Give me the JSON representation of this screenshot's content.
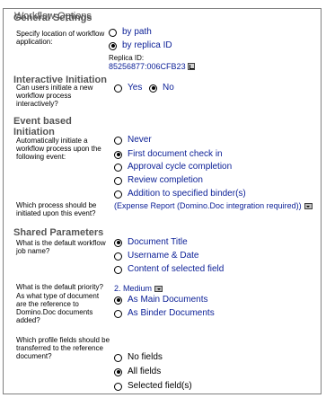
{
  "legend": "Workflow Options",
  "sections": {
    "general": "General Settings",
    "interactive": "Interactive Initiation",
    "event": [
      "Event based",
      "Initiation"
    ],
    "shared": "Shared Parameters"
  },
  "location": {
    "question": [
      "Specify location of workflow",
      "application:"
    ],
    "options": [
      "by path",
      "by replica ID"
    ],
    "selected": 1,
    "replica_label": "Replica ID:",
    "replica_value": "85256877:006CFB23"
  },
  "interactive": {
    "question": [
      "Can users initiate a new",
      "workflow process",
      "interactively?"
    ],
    "yes": "Yes",
    "no": "No",
    "selected": "no"
  },
  "event": {
    "question": [
      "Automatically initiate a",
      "workflow process upon the",
      "following event:"
    ],
    "options": [
      "Never",
      "First document check in",
      "Approval cycle completion",
      "Review completion",
      "Addition to specified binder(s)"
    ],
    "selected": 1,
    "process_question": [
      "Which process should be",
      "initiated upon this event?"
    ],
    "process_value": "(Expense Report (Domino.Doc integration required))"
  },
  "shared": {
    "job_question": [
      "What is the default workflow",
      "job name?"
    ],
    "job_options": [
      "Document Title",
      "Username & Date",
      "Content of selected field"
    ],
    "job_selected": 0,
    "priority_question": "What is the default priority?",
    "priority_value": "2. Medium",
    "doctype_question": [
      "As what type of document",
      "are the reference to",
      "Domino.Doc documents",
      "added?"
    ],
    "doctype_options": [
      "As Main Documents",
      "As Binder Documents"
    ],
    "doctype_selected": 0,
    "fields_question": [
      "Which profile fields should be",
      "transferred to the reference",
      "document?"
    ],
    "fields_options": [
      "No fields",
      "All fields",
      "Selected field(s)"
    ],
    "fields_selected": 1
  }
}
